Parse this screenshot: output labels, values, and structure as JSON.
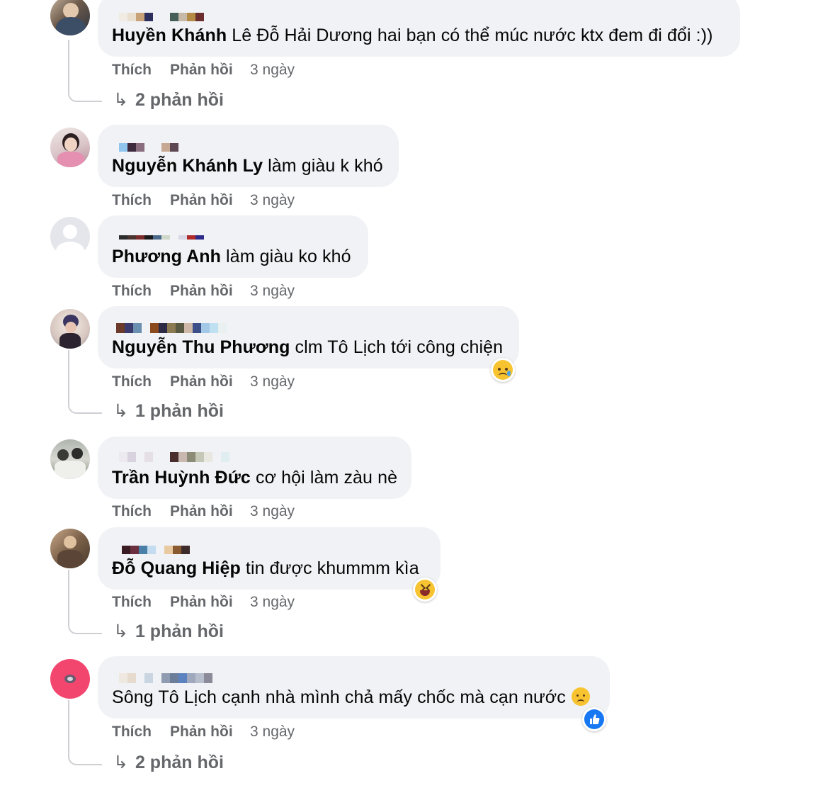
{
  "actions": {
    "like": "Thích",
    "reply": "Phản hồi",
    "time": "3 ngày"
  },
  "comments": [
    {
      "author": "Huyền Khánh",
      "text": " Lê Đỗ Hải Dương hai bạn có thể múc nước ktx đem đi đổi :))",
      "replies": "2 phản hồi"
    },
    {
      "author": "Nguyễn Khánh Ly",
      "text": " làm giàu k khó",
      "replies": ""
    },
    {
      "author": "Phương Anh",
      "text": " làm giàu ko khó",
      "replies": ""
    },
    {
      "author": "Nguyễn Thu Phương",
      "text": " clm Tô Lịch tới công chiện",
      "replies": "1 phản hồi"
    },
    {
      "author": "Trần Huỳnh Đức",
      "text": " cơ hội làm zàu nè",
      "replies": ""
    },
    {
      "author": "Đỗ Quang Hiệp",
      "text": " tin được khummm kìa",
      "replies": "1 phản hồi"
    },
    {
      "author": "",
      "text": "Sông Tô Lịch cạnh nhà mình chả mấy chốc mà cạn nước",
      "replies": "2 phản hồi"
    }
  ],
  "icons": [
    "reply-arrow-icon",
    "sad-emoji-icon",
    "laughing-emoji-icon",
    "thumbs-up-icon",
    "default-avatar-icon"
  ],
  "colors": {
    "bubble": "#f0f2f5",
    "meta_text": "#65676b",
    "like_blue": "#1877f2",
    "emoji_yellow": "#f7c330",
    "avatar_pink": "#f3466f"
  }
}
